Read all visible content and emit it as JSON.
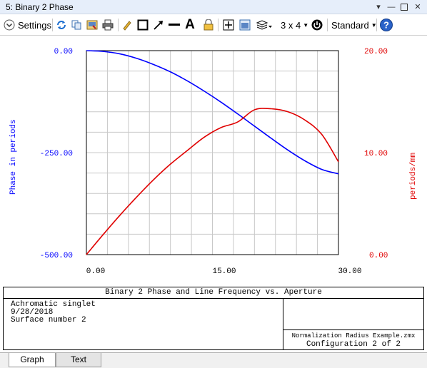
{
  "window": {
    "title": "5: Binary 2 Phase"
  },
  "toolbar": {
    "settings_label": "Settings",
    "layout_label": "3 x 4",
    "standard_label": "Standard"
  },
  "colors": {
    "phase": "#0000ff",
    "frequency": "#e00000",
    "grid": "#c8c8c8"
  },
  "chart_data": {
    "type": "line",
    "title": "Binary 2 Phase and Line Frequency vs. Aperture",
    "x": [
      0,
      2,
      4,
      6,
      8,
      10,
      12,
      14,
      16,
      18,
      20,
      22,
      24,
      26,
      28,
      30
    ],
    "xlim": [
      0,
      30
    ],
    "xticks": [
      "0.00",
      "15.00",
      "30.00"
    ],
    "y_left": {
      "label": "Phase in periods",
      "lim": [
        -500,
        0
      ],
      "ticks": [
        "0.00",
        "-250.00",
        "-500.00"
      ]
    },
    "y_right": {
      "label": "periods/mm",
      "lim": [
        0,
        20
      ],
      "ticks": [
        "20.00",
        "10.00",
        "0.00"
      ]
    },
    "series": [
      {
        "axis": "left",
        "color": "#0000ff",
        "values": [
          0,
          -2,
          -8,
          -19,
          -34,
          -52,
          -74,
          -99,
          -126,
          -155,
          -185,
          -215,
          -244,
          -270,
          -291,
          -302
        ]
      },
      {
        "axis": "right",
        "color": "#e00000",
        "values": [
          0,
          1.97,
          3.87,
          5.66,
          7.35,
          8.87,
          10.2,
          11.5,
          12.45,
          13.0,
          14.2,
          14.3,
          14.0,
          13.2,
          11.8,
          9.1
        ]
      }
    ]
  },
  "info": {
    "title": "Binary 2 Phase and Line Frequency vs. Aperture",
    "lines": [
      "Achromatic singlet",
      "9/28/2018",
      "Surface number 2"
    ],
    "file": "Normalization Radius Example.zmx",
    "config": "Configuration 2 of 2"
  },
  "tabs": [
    {
      "label": "Graph",
      "active": true
    },
    {
      "label": "Text",
      "active": false
    }
  ]
}
